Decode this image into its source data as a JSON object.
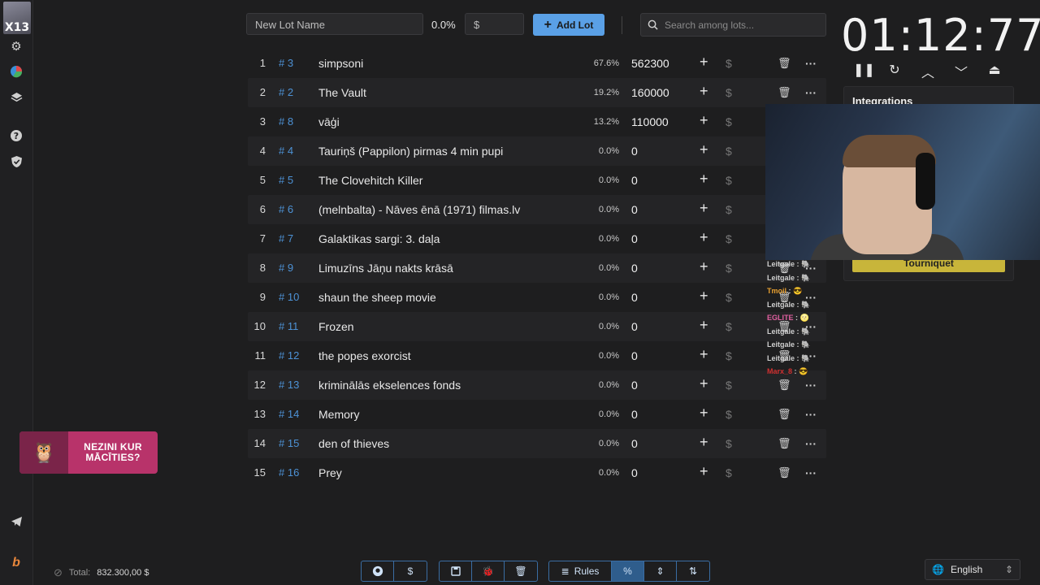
{
  "channel_badge": "X13",
  "sidebar": {
    "icons": [
      "gear-icon",
      "pie-chart-icon",
      "layers-icon",
      "help-icon",
      "shield-check-icon",
      "telegram-icon",
      "brand-icon"
    ]
  },
  "promo": {
    "text": "NEZINI KUR MĀCĪTIES?"
  },
  "topbar": {
    "name_placeholder": "New Lot Name",
    "percent": "0.0%",
    "amount_placeholder": "$",
    "add_label": "Add Lot",
    "search_placeholder": "Search among lots..."
  },
  "lots": [
    {
      "idx": "1",
      "id": "# 3",
      "name": "simpsoni",
      "pct": "67.6%",
      "amount": "562300"
    },
    {
      "idx": "2",
      "id": "# 2",
      "name": "The Vault",
      "pct": "19.2%",
      "amount": "160000"
    },
    {
      "idx": "3",
      "id": "# 8",
      "name": "vāģi",
      "pct": "13.2%",
      "amount": "110000"
    },
    {
      "idx": "4",
      "id": "# 4",
      "name": "Tauriņš (Pappilon) pirmas 4 min pupi",
      "pct": "0.0%",
      "amount": "0"
    },
    {
      "idx": "5",
      "id": "# 5",
      "name": "The Clovehitch Killer",
      "pct": "0.0%",
      "amount": "0"
    },
    {
      "idx": "6",
      "id": "# 6",
      "name": "(melnbalta) - Nāves ēnā (1971) filmas.lv",
      "pct": "0.0%",
      "amount": "0"
    },
    {
      "idx": "7",
      "id": "# 7",
      "name": "Galaktikas sargi: 3. daļa",
      "pct": "0.0%",
      "amount": "0"
    },
    {
      "idx": "8",
      "id": "# 9",
      "name": "Limuzīns Jāņu nakts krāsā",
      "pct": "0.0%",
      "amount": "0"
    },
    {
      "idx": "9",
      "id": "# 10",
      "name": "shaun the sheep movie",
      "pct": "0.0%",
      "amount": "0"
    },
    {
      "idx": "10",
      "id": "# 11",
      "name": "Frozen",
      "pct": "0.0%",
      "amount": "0"
    },
    {
      "idx": "11",
      "id": "# 12",
      "name": "the popes exorcist",
      "pct": "0.0%",
      "amount": "0"
    },
    {
      "idx": "12",
      "id": "# 13",
      "name": "kriminālās ekselences fonds",
      "pct": "0.0%",
      "amount": "0"
    },
    {
      "idx": "13",
      "id": "# 14",
      "name": "Memory",
      "pct": "0.0%",
      "amount": "0"
    },
    {
      "idx": "14",
      "id": "# 15",
      "name": "den of thieves",
      "pct": "0.0%",
      "amount": "0"
    },
    {
      "idx": "15",
      "id": "# 16",
      "name": "Prey",
      "pct": "0.0%",
      "amount": "0"
    }
  ],
  "timer": {
    "value": "01:12:77"
  },
  "integrations": {
    "title": "Integrations",
    "tournament_label": "Tourniquet"
  },
  "chat": [
    {
      "user": "Leitgale",
      "msg": "🐘"
    },
    {
      "user": "Leitgale",
      "msg": "🐘"
    },
    {
      "user": "Tmoil",
      "msg": "😎"
    },
    {
      "user": "Leitgale",
      "msg": "🐘"
    },
    {
      "user": "EGLITE",
      "msg": "🌝"
    },
    {
      "user": "Leitgale",
      "msg": "🐘"
    },
    {
      "user": "Leitgale",
      "msg": "🐘"
    },
    {
      "user": "Leitgale",
      "msg": "🐘"
    },
    {
      "user": "Marx_8",
      "msg": "😎"
    }
  ],
  "footer": {
    "total_label": "Total:",
    "total_value": "832.300,00 $",
    "rules_label": "Rules",
    "language": "English"
  },
  "colors": {
    "accent": "#5aa0e6",
    "lot_id": "#4d92d6",
    "tournament": "#c8b53a"
  }
}
